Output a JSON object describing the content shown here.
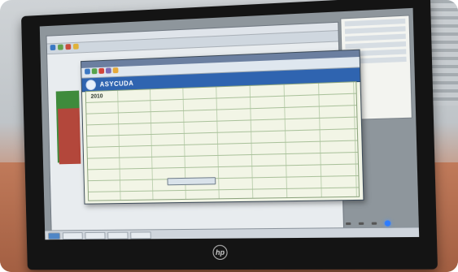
{
  "scene": {
    "description_free": true
  },
  "monitor": {
    "brand_label": "",
    "hp_mark": "hp"
  },
  "app": {
    "banner_title": "ASYCUDA",
    "form_code": "2010"
  },
  "colors": {
    "banner_blue": "#2f64b0",
    "form_green": "#f2f5e6",
    "desk_wood": "#b87655",
    "power_led": "#2e7cff"
  },
  "icons": [
    "un-emblem-icon",
    "hp-logo-icon",
    "power-led-icon"
  ]
}
